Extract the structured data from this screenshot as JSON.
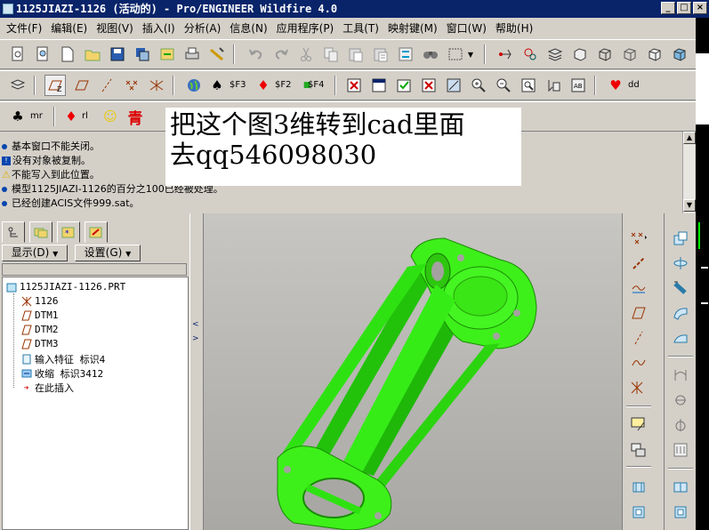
{
  "window": {
    "title": "1125JIAZI-1126 (活动的) - Pro/ENGINEER Wildfire 4.0",
    "controls": [
      "_",
      "□",
      "×"
    ]
  },
  "menu": [
    "文件(F)",
    "编辑(E)",
    "视图(V)",
    "插入(I)",
    "分析(A)",
    "信息(N)",
    "应用程序(P)",
    "工具(T)",
    "映射键(M)",
    "窗口(W)",
    "帮助(H)"
  ],
  "toolbar2": {
    "f3": "$F3",
    "f2": "$F2",
    "f4": "$F4",
    "dd": "dd"
  },
  "toolbar3": {
    "mr": "mr",
    "rl": "rl",
    "chinese_glyph": "青"
  },
  "overlay_text": {
    "line1": "把这个图3维转到cad里面",
    "line2": "去qq546098030"
  },
  "messages": [
    "基本窗口不能关闭。",
    "没有对象被复制。",
    "不能写入到此位置。",
    "模型1125JIAZI-1126的百分之100已经被处理。",
    "已经创建ACIS文件999.sat。"
  ],
  "left_panel": {
    "show_button": "显示(D)",
    "settings_button": "设置(G)"
  },
  "tree": {
    "root": "1125JIAZI-1126.PRT",
    "items": [
      "1126",
      "DTM1",
      "DTM2",
      "DTM3",
      "输入特征 标识4",
      "收缩 标识3412",
      "在此插入"
    ]
  },
  "colors": {
    "titlebar": "#0a246a",
    "model_green": "#33ee11",
    "viewport_bg": "#b8b7b4",
    "chrome": "#d4d0c8"
  },
  "icons": {
    "right_toolbar_1": [
      "datum-point-icon",
      "datum-axis-icon",
      "datum-curve-icon",
      "datum-plane-icon",
      "sketch-icon",
      "curve-icon",
      "coordinate-icon",
      "sketcher-icon",
      "palette-icon",
      "hole-icon"
    ],
    "right_toolbar_2": [
      "extrude-icon",
      "revolve-icon",
      "sweep-icon",
      "blend-icon",
      "shell-icon",
      "rib-icon",
      "draft-icon",
      "round-icon",
      "pattern-icon",
      "mirror-icon",
      "offset-icon"
    ]
  }
}
